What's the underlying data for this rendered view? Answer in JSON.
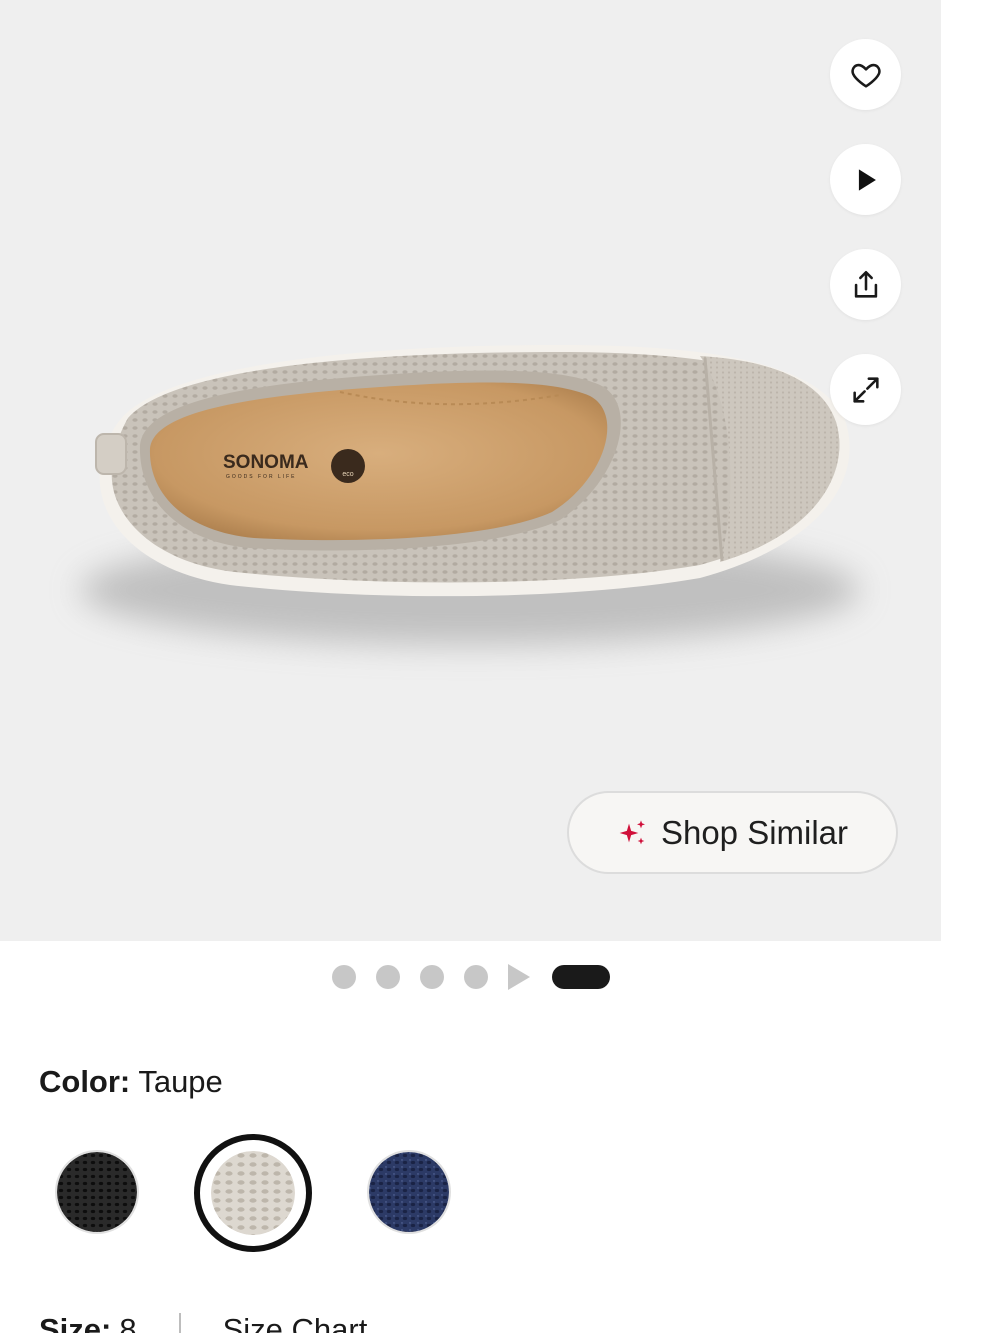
{
  "product_image": {
    "alt": "Sonoma Goods for Life women's taupe knit ballet flat",
    "insole_brand": "SONOMA",
    "insole_tagline": "GOODS FOR LIFE",
    "insole_badge": "eco"
  },
  "side_actions": [
    {
      "name": "favorite",
      "icon": "heart-icon"
    },
    {
      "name": "play-video",
      "icon": "play-icon"
    },
    {
      "name": "share",
      "icon": "share-icon"
    },
    {
      "name": "expand",
      "icon": "expand-icon"
    }
  ],
  "shop_similar": {
    "label": "Shop Similar",
    "icon": "sparkle-icon",
    "accent": "#d0103a"
  },
  "carousel": {
    "total_items": 6,
    "active_index": 5,
    "video_index": 4
  },
  "color": {
    "label": "Color:",
    "selected": "Taupe"
  },
  "swatches": [
    {
      "name": "Black",
      "color": "#1c1c1c",
      "selected": false
    },
    {
      "name": "Taupe",
      "color": "#ccc6bd",
      "selected": true
    },
    {
      "name": "Navy",
      "color": "#27325a",
      "selected": false
    }
  ],
  "size": {
    "label": "Size:",
    "value": "8",
    "chart_label": "Size Chart"
  }
}
